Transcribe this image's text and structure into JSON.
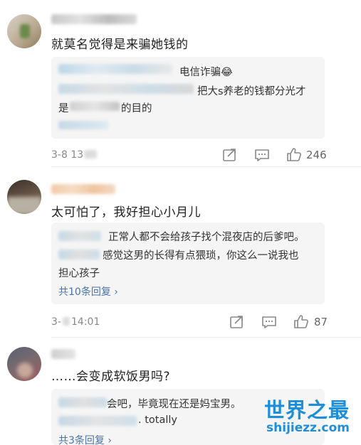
{
  "comments": [
    {
      "text": "就莫名觉得是来骗她钱的",
      "replies": [
        {
          "text": "电信诈骗😂"
        },
        {
          "text": "把大s养老的钱都分光才"
        },
        {
          "prefix": "是",
          "suffix": "的目的"
        }
      ],
      "time": "3-8 13",
      "likes": "246"
    },
    {
      "text": "太可怕了，我好担心小月儿",
      "replies": [
        {
          "text": "正常人都不会给孩子找个混夜店的后爹吧。"
        },
        {
          "text": "感觉这男的长得有点猥琐，你这么一说我也"
        },
        {
          "text": "担心孩子"
        }
      ],
      "more_label": "共10条回复 ›",
      "time": "3-",
      "time_suffix": "14:01",
      "likes": "87"
    },
    {
      "text": "……会变成软饭男吗?",
      "replies": [
        {
          "text": "会吧，毕竟现在还是妈宝男。"
        },
        {
          "text": ". totally"
        }
      ],
      "more_label": "共3条回复 ›"
    }
  ],
  "watermark": {
    "title": "世界之最",
    "url": "shijiezz.com"
  },
  "colors": {
    "link": "#4a74a8",
    "reply_bg": "#f5f5f5",
    "watermark": "#1d8fd8"
  },
  "icons": [
    "share-icon",
    "comment-icon",
    "like-icon"
  ]
}
